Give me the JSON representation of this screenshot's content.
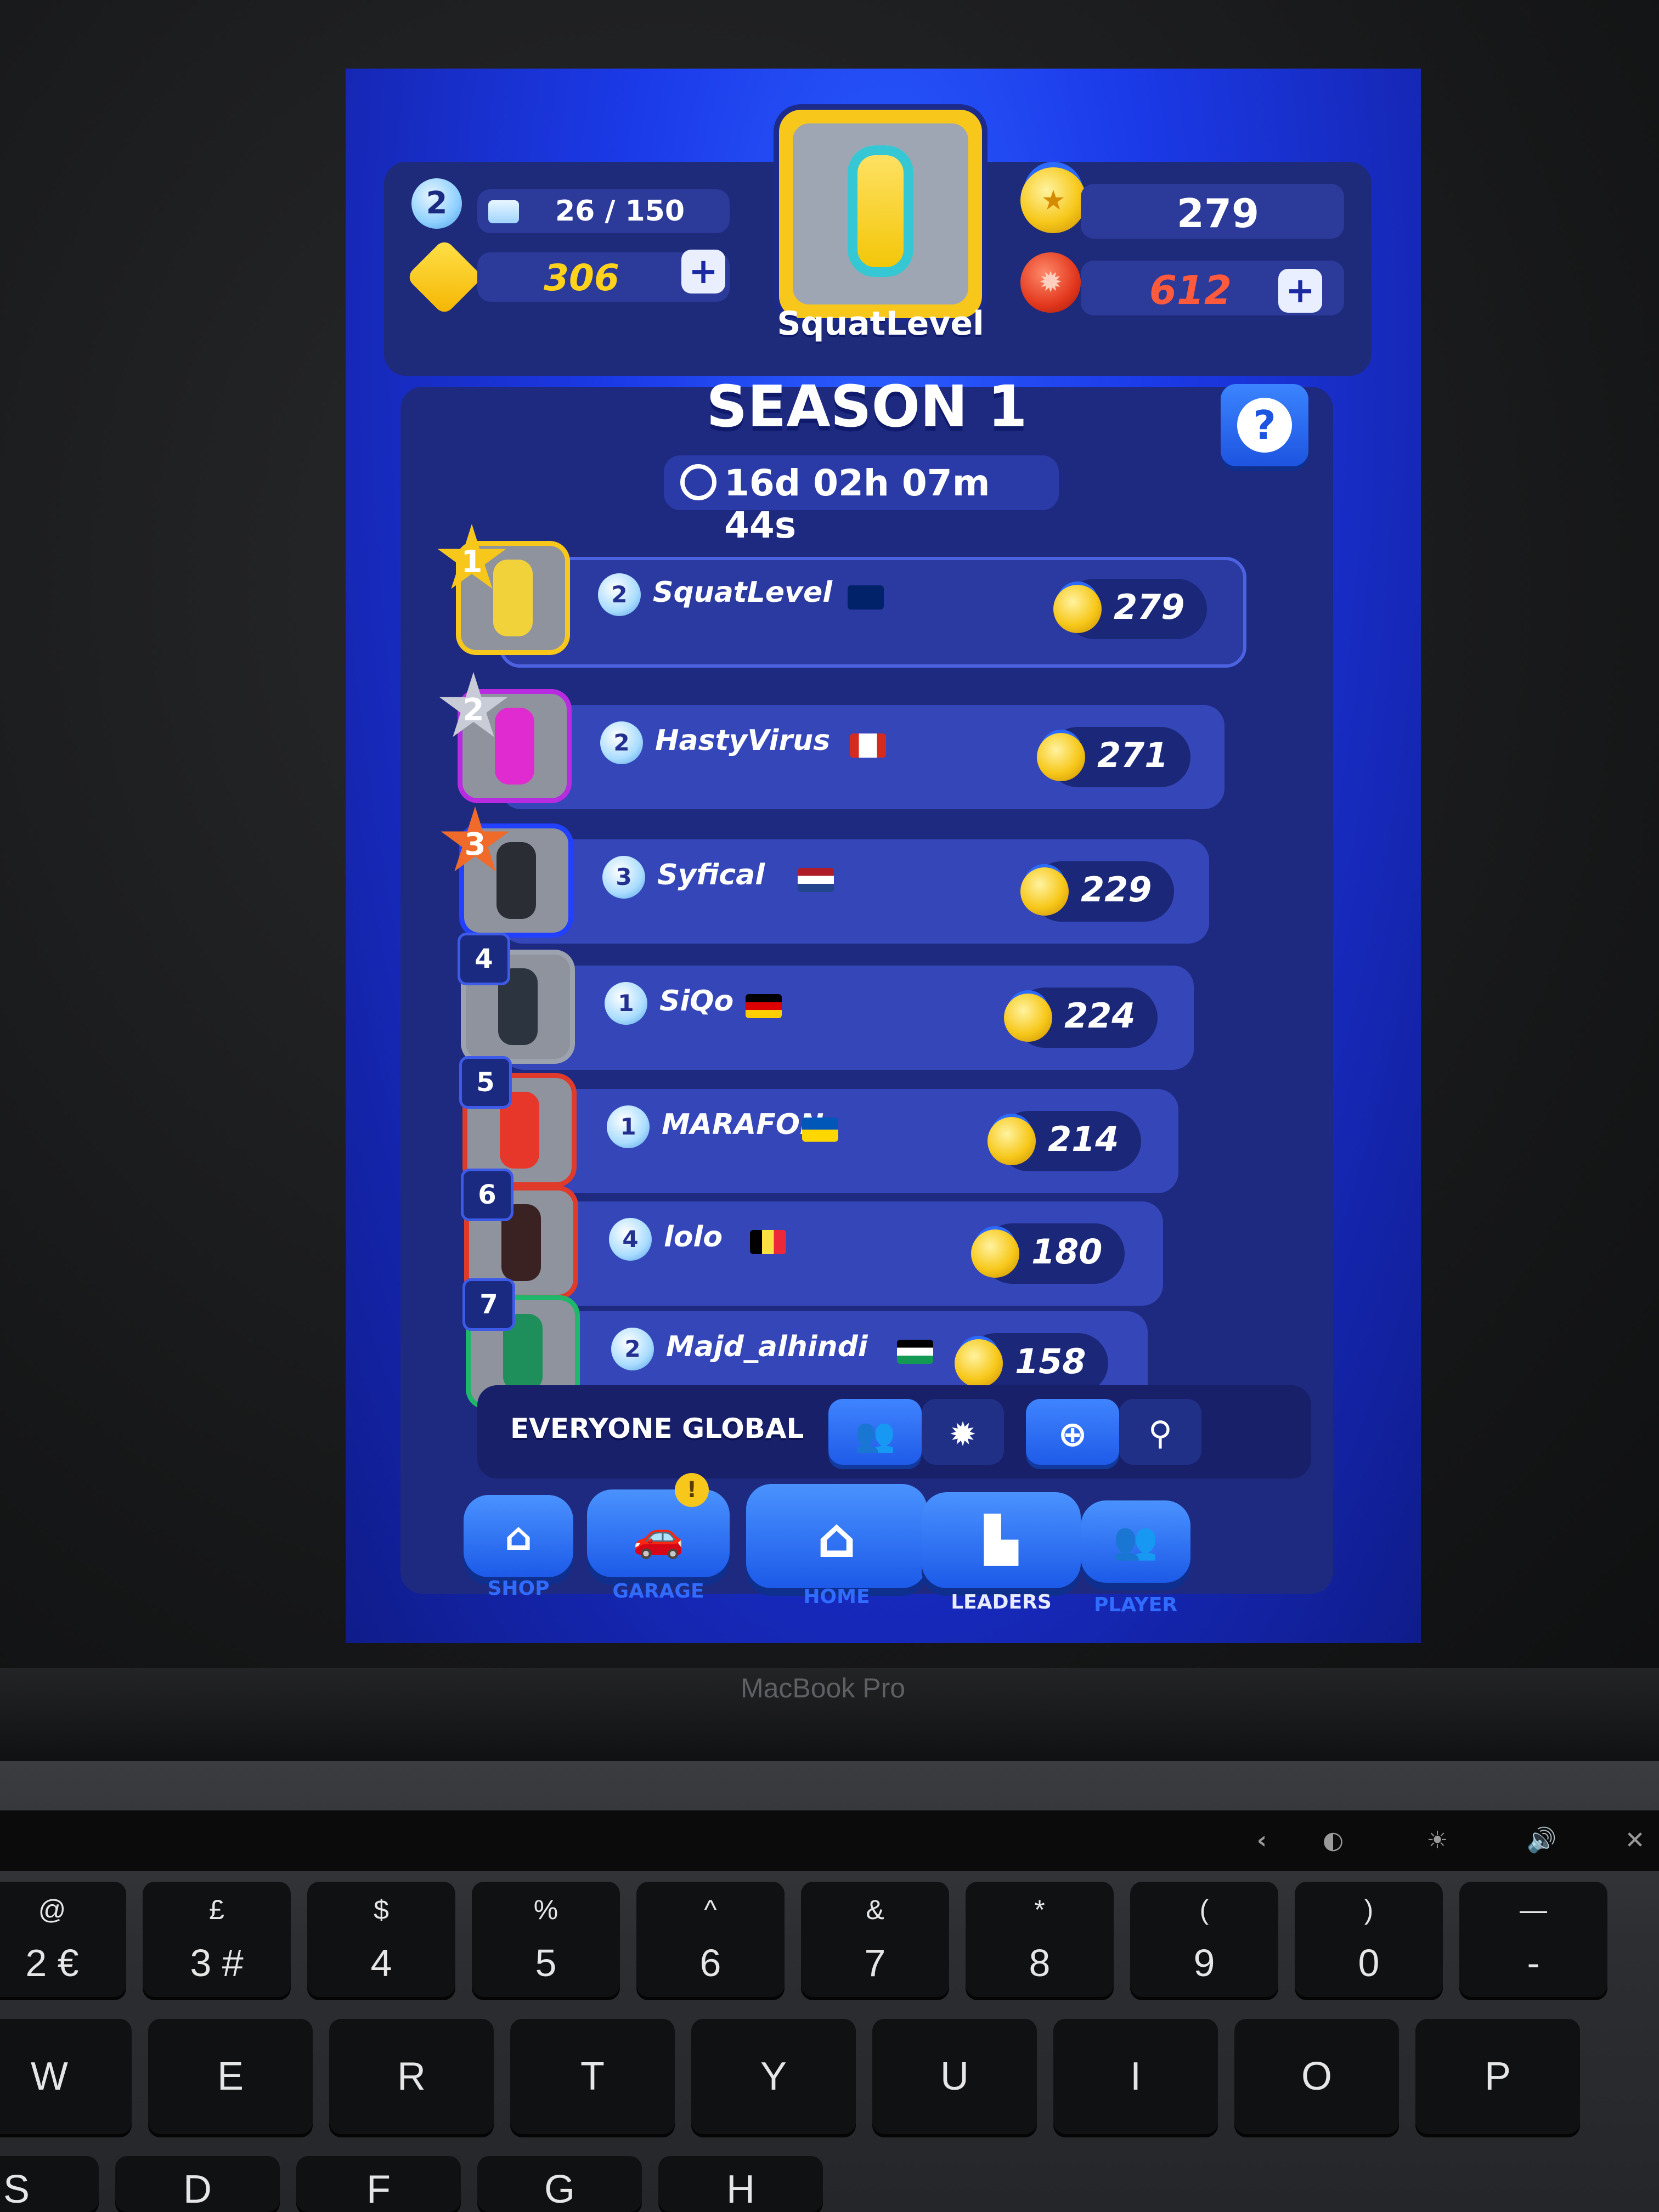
{
  "header": {
    "player_level": "2",
    "xp": "26 / 150",
    "gems": "306",
    "trophies": "279",
    "rubies": "612",
    "player_name": "SquatLevel"
  },
  "season": {
    "title": "SEASON 1",
    "timer": "16d 02h 07m 44s",
    "help": "?"
  },
  "leaderboard": [
    {
      "rank": "1",
      "level": "2",
      "name": "SquatLevel",
      "flag": "uk",
      "trophies": "279"
    },
    {
      "rank": "2",
      "level": "2",
      "name": "HastyVirus",
      "flag": "ca",
      "trophies": "271"
    },
    {
      "rank": "3",
      "level": "3",
      "name": "Syfical",
      "flag": "nl",
      "trophies": "229"
    },
    {
      "rank": "4",
      "level": "1",
      "name": "SiQo",
      "flag": "de",
      "trophies": "224"
    },
    {
      "rank": "5",
      "level": "1",
      "name": "MARAFON",
      "flag": "ua",
      "trophies": "214"
    },
    {
      "rank": "6",
      "level": "4",
      "name": "lolo",
      "flag": "be",
      "trophies": "180"
    },
    {
      "rank": "7",
      "level": "2",
      "name": "Majd_alhindi",
      "flag": "ps",
      "trophies": "158"
    }
  ],
  "filter": {
    "label": "EVERYONE GLOBAL"
  },
  "nav": {
    "shop": "SHOP",
    "garage": "GARAGE",
    "garage_badge": "!",
    "home": "HOME",
    "leaders": "LEADERS",
    "player": "PLAYER"
  },
  "device": {
    "brand": "MacBook Pro"
  },
  "keyboard": {
    "row1": [
      {
        "top": "@",
        "bot": "2 €"
      },
      {
        "top": "£",
        "bot": "3 #"
      },
      {
        "top": "$",
        "bot": "4"
      },
      {
        "top": "%",
        "bot": "5"
      },
      {
        "top": "^",
        "bot": "6"
      },
      {
        "top": "&",
        "bot": "7"
      },
      {
        "top": "*",
        "bot": "8"
      },
      {
        "top": "(",
        "bot": "9"
      },
      {
        "top": ")",
        "bot": "0"
      },
      {
        "top": "—",
        "bot": "-"
      }
    ],
    "row2": [
      "W",
      "E",
      "R",
      "T",
      "Y",
      "U",
      "I",
      "O",
      "P"
    ],
    "row3": [
      "S",
      "D",
      "F",
      "G",
      "H"
    ]
  }
}
